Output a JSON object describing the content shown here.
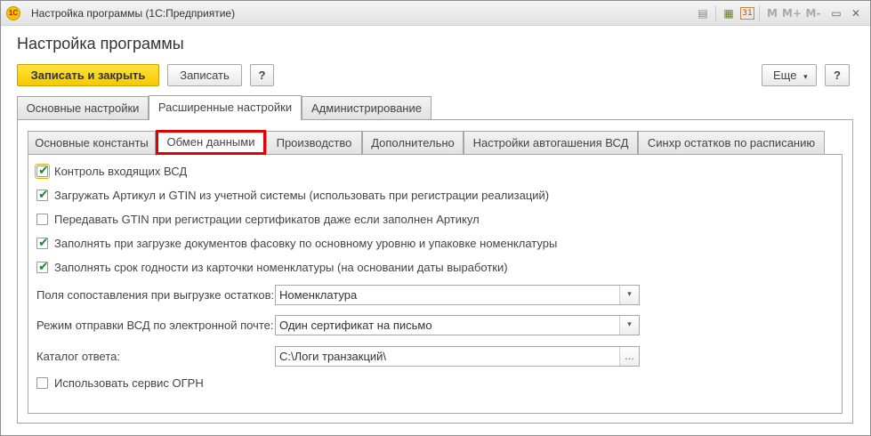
{
  "window": {
    "title": "Настройка программы  (1С:Предприятие)",
    "logo_text": "1С",
    "toolbar_icons": [
      "doc-icon",
      "calculator-icon",
      "calendar-icon",
      "memory-m-icon",
      "memory-m-plus-icon",
      "memory-m-minus-icon",
      "minimize-icon",
      "close-icon"
    ],
    "toolbar_glyphs": [
      "▤",
      "▦",
      "31",
      "M",
      "M+",
      "M-",
      "▭",
      "✕"
    ]
  },
  "page_title": "Настройка программы",
  "actions": {
    "save_close": "Записать и закрыть",
    "save": "Записать",
    "help": "?",
    "more": "Еще",
    "more_arrow": "▾",
    "help_right": "?"
  },
  "tabs": [
    {
      "label": "Основные настройки"
    },
    {
      "label": "Расширенные настройки"
    },
    {
      "label": "Администрирование"
    }
  ],
  "subtabs": [
    {
      "label": "Основные константы"
    },
    {
      "label": "Обмен данными"
    },
    {
      "label": "Производство"
    },
    {
      "label": "Дополнительно"
    },
    {
      "label": "Настройки автогашения ВСД"
    },
    {
      "label": "Синхр остатков по расписанию"
    }
  ],
  "options": [
    {
      "label": "Контроль входящих ВСД",
      "checked": true
    },
    {
      "label": "Загружать Артикул и GTIN из учетной системы (использовать при регистрации реализаций)",
      "checked": true
    },
    {
      "label": "Передавать GTIN при регистрации сертификатов даже если заполнен Артикул",
      "checked": false
    },
    {
      "label": "Заполнять при загрузке документов фасовку по основному уровню и упаковке номенклатуры",
      "checked": true
    },
    {
      "label": "Заполнять срок годности из карточки номенклатуры (на основании даты выработки)",
      "checked": true
    }
  ],
  "fields": {
    "mapping": {
      "label": "Поля сопоставления при выгрузке остатков:",
      "value": "Номенклатура"
    },
    "email_mode": {
      "label": "Режим отправки ВСД по электронной почте:",
      "value": "Один сертификат на письмо"
    },
    "reply_dir": {
      "label": "Каталог ответа:",
      "value": "С:\\Логи транзакций\\"
    }
  },
  "ogrn_option": {
    "label": "Использовать сервис ОГРН",
    "checked": false
  },
  "glyphs": {
    "dropdown": "▾",
    "ellipsis": "...",
    "check": "✔"
  },
  "colors": {
    "accent_yellow": "#f6c900",
    "highlight_red": "#e30000",
    "check_green": "#1a8a2a"
  }
}
